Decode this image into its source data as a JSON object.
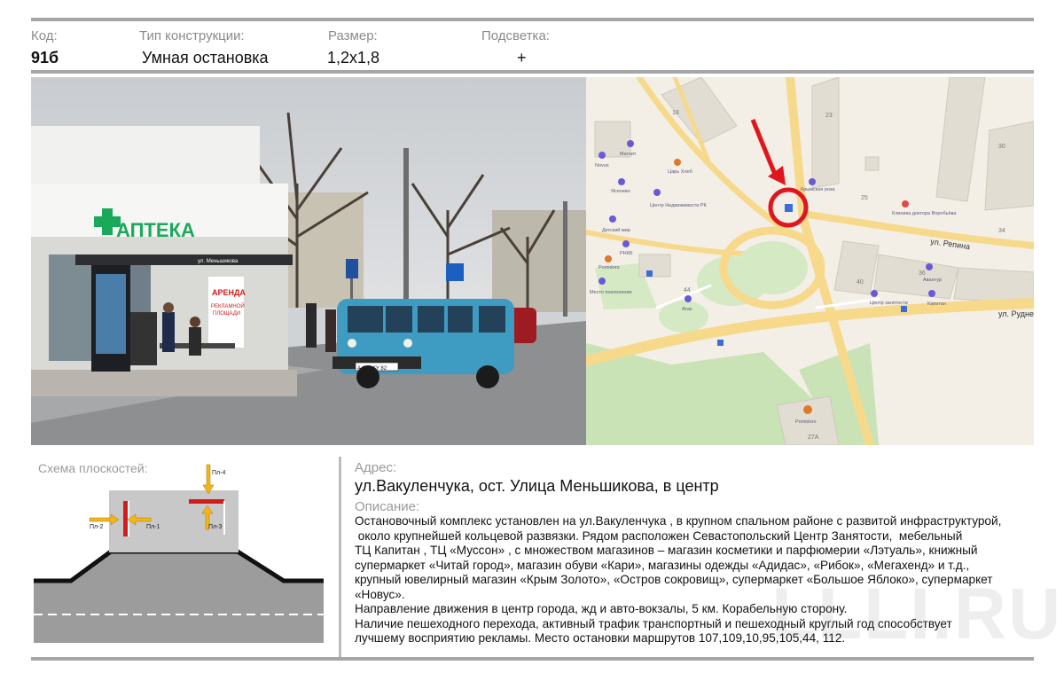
{
  "header": {
    "code_label": "Код:",
    "code_value": "91б",
    "type_label": "Тип конструкции:",
    "type_value": "Умная остановка",
    "size_label": "Размер:",
    "size_value": "1,2х1,8",
    "light_label": "Подсветка:",
    "light_value": "+"
  },
  "photo": {
    "pharmacy_sign": "АПТЕКА",
    "shelter_name": "ул. Меньшикова",
    "ad_title": "АРЕНДА",
    "ad_sub1": "РЕКЛАМНОЙ",
    "ad_sub2": "ПЛОЩАДИ",
    "plate": "А 189 КУ 82"
  },
  "map": {
    "street1": "ул. Репина",
    "street2": "ул. Рудне",
    "poi_khleb": "Царь Хлеб",
    "poi_magnit": "Магнит",
    "poi_novus": "Novus",
    "poi_yasenevo": "Ясенево",
    "poi_center": "Центр Недвижимости РК",
    "poi_detsky": "Детский мир",
    "poi_rnkb": "РНКБ",
    "poi_pomidoro": "Pomidoro",
    "poi_mesto": "Место поклонения",
    "poi_atak": "Атак",
    "poi_krym": "Крымская роза",
    "poi_clinic": "Клиника доктора Воробьёва",
    "poi_avantur": "Авантур",
    "poi_zanyatost": "Центр занятости",
    "poi_kapitan": "Капитан",
    "poi_pomidoro2": "Pomidoro",
    "num_18": "18",
    "num_23": "23",
    "num_30": "30",
    "num_25": "25",
    "num_34": "34",
    "num_36": "36",
    "num_40": "40",
    "num_44": "44",
    "num_27a": "27А"
  },
  "scheme": {
    "title": "Схема плоскостей:",
    "p1": "Пл-1",
    "p2": "Пл-2",
    "p3": "Пл-3",
    "p4": "Пл-4"
  },
  "address": {
    "label": "Адрес:",
    "value": "ул.Вакуленчука, ост. Улица Меньшикова, в центр"
  },
  "description": {
    "label": "Описание:",
    "lines": [
      "Остановочный комплекс установлен на ул.Вакуленчука , в крупном спальном районе с развитой инфраструктурой,",
      " около крупнейшей кольцевой развязки. Рядом расположен Севастопольский Центр Занятости,  мебельный",
      "ТЦ Капитан , ТЦ «Муссон» , с множеством магазинов – магазин косметики и парфюмерии «Лэтуаль», книжный",
      "супермаркет «Читай город», магазин обуви «Кари», магазины одежды  «Адидас», «Рибок», «Мегахенд» и т.д.,",
      "крупный  ювелирный магазин «Крым Золото», «Остров сокровищ», супермаркет «Большое Яблоко», супермаркет",
      "«Новус».",
      "Направление движения в  центр города, жд и авто-вокзалы, 5 км. Корабельную сторону.",
      "Наличие пешеходного перехода, активный трафик транспортный и пешеходный круглый год  способствует",
      "лучшему восприятию рекламы. Место остановки маршрутов  107,109,10,95,105,44, 112."
    ]
  },
  "watermark": "LLLI.RU"
}
